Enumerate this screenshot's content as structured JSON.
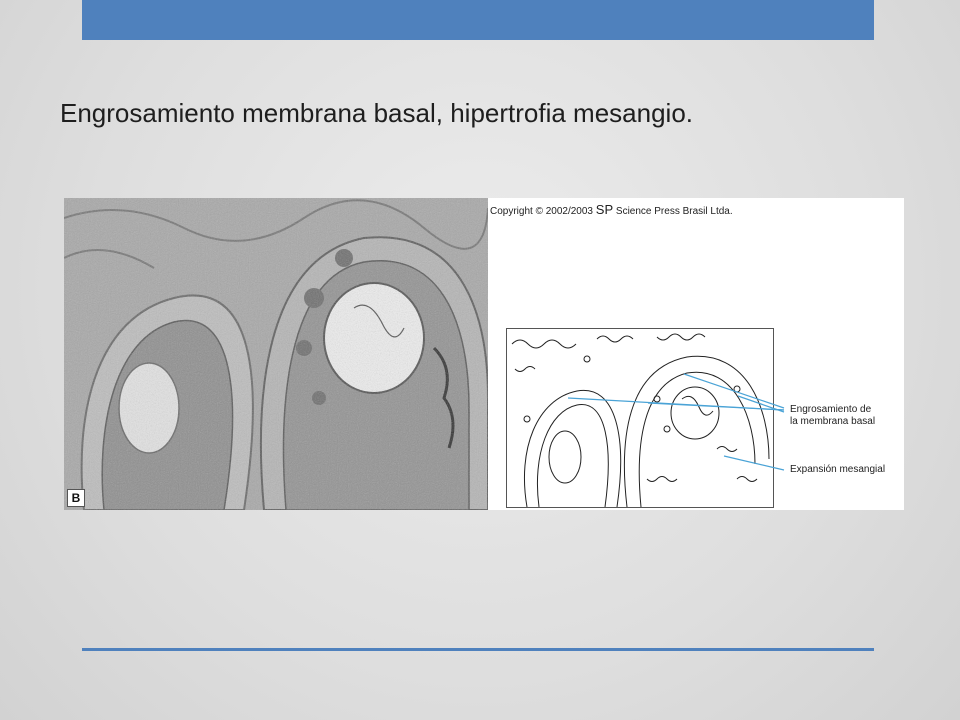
{
  "slide": {
    "title": "Engrosamiento membrana basal, hipertrofia mesangio.",
    "accent_color": "#4f81bd"
  },
  "figure": {
    "panel_letter": "B",
    "copyright_prefix": "Copyright © 2002/2003",
    "copyright_sp": "SP",
    "copyright_suffix": "Science Press Brasil Ltda.",
    "labels": {
      "membrana_line1": "Engrosamiento de",
      "membrana_line2": "la membrana basal",
      "mesangial": "Expansión mesangial"
    },
    "label_line_color": "#4aa3d6"
  }
}
